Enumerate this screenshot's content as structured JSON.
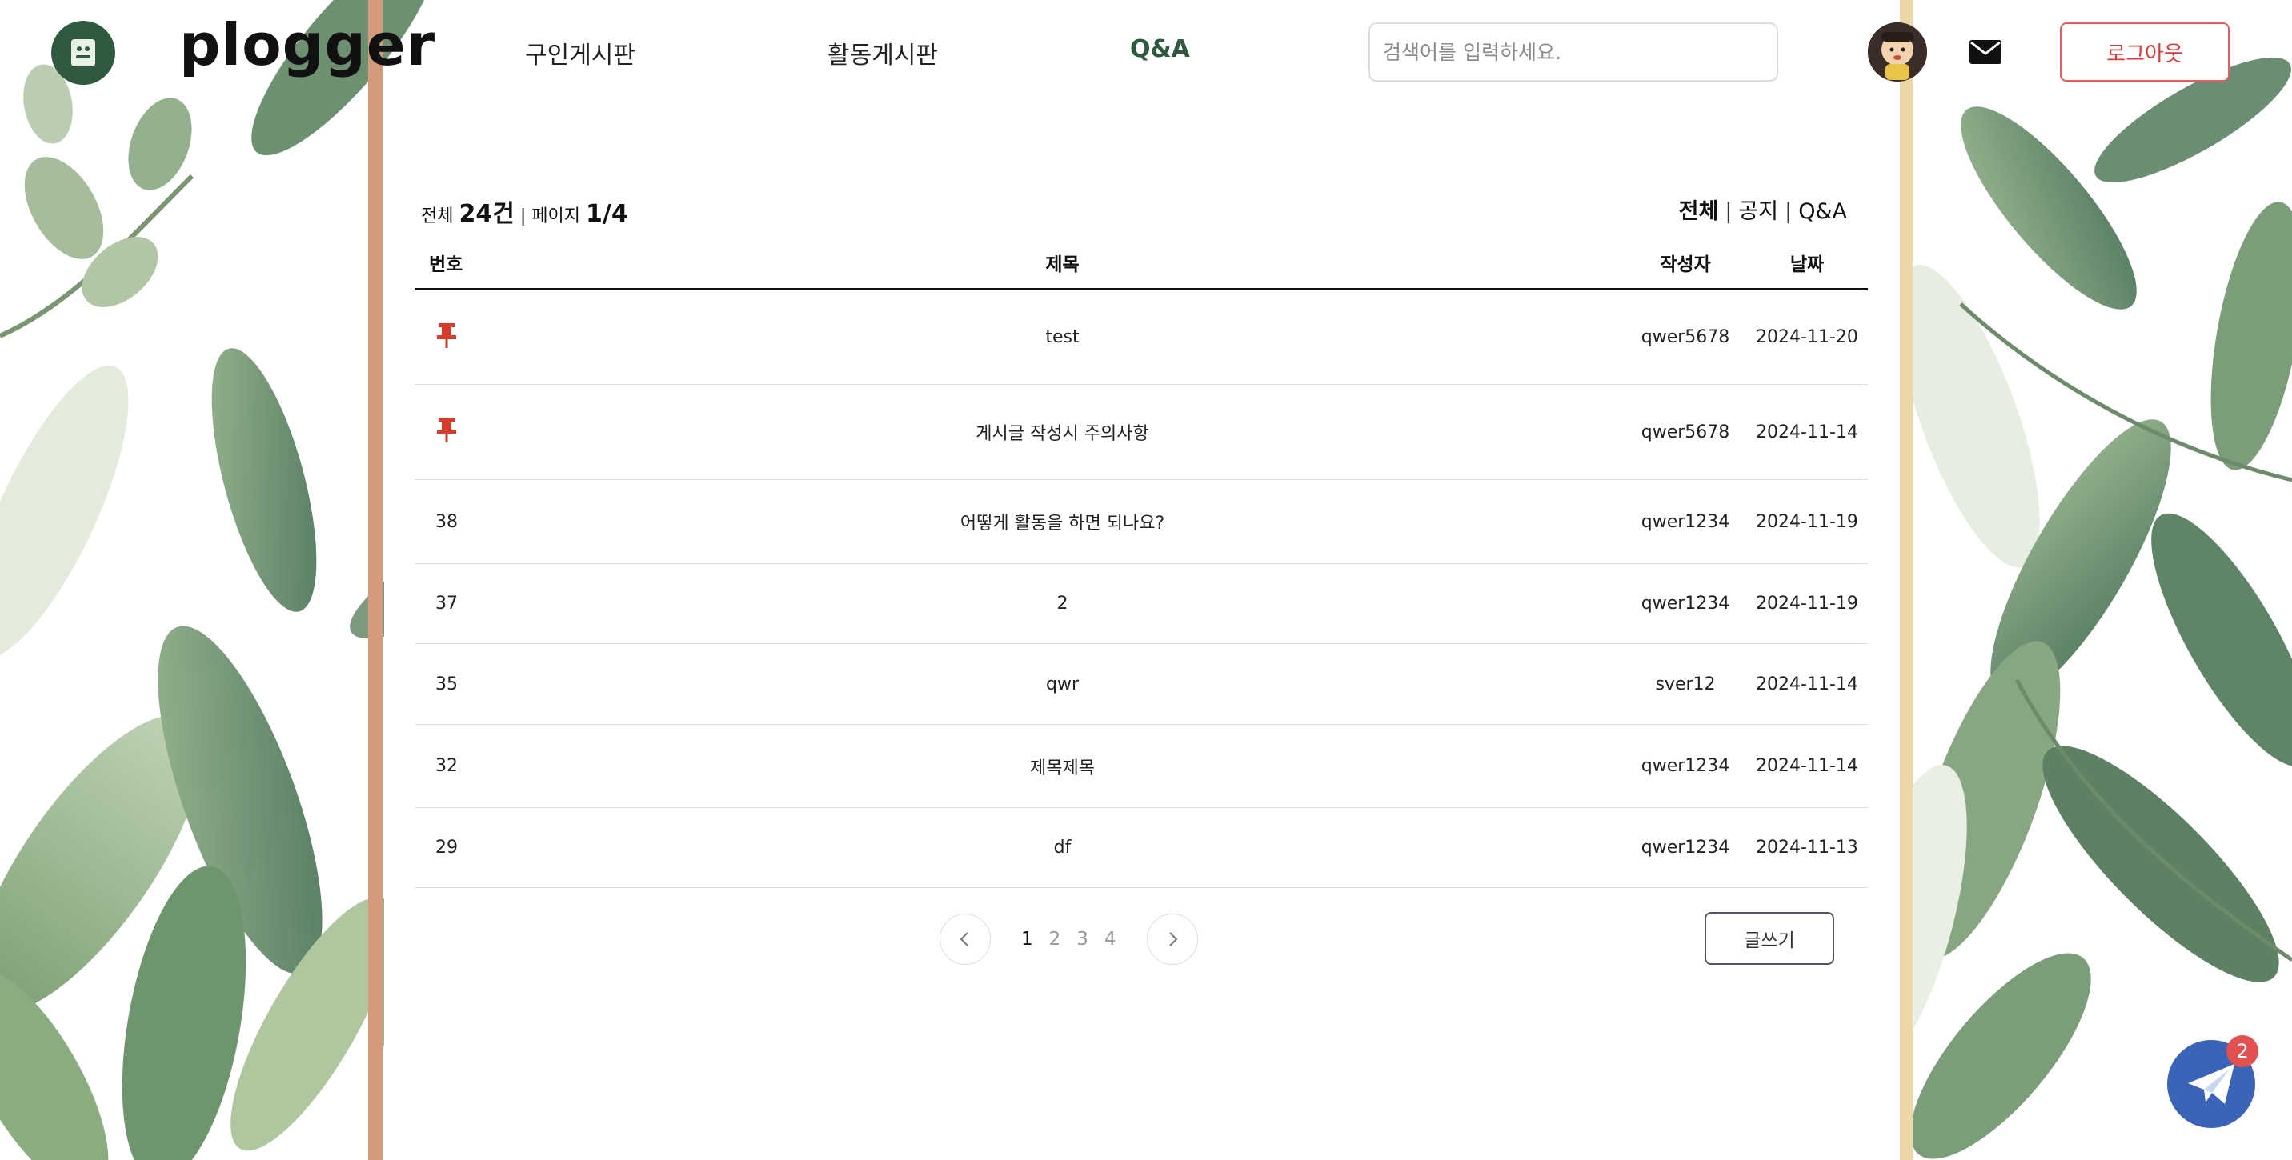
{
  "brand": {
    "name": "plogger"
  },
  "nav": [
    {
      "label": "구인게시판",
      "active": false
    },
    {
      "label": "활동게시판",
      "active": false
    },
    {
      "label": "Q&A",
      "active": true
    }
  ],
  "search": {
    "placeholder": "검색어를 입력하세요."
  },
  "header": {
    "logout_label": "로그아웃",
    "message_icon": "mail-icon",
    "accent_color": "#2f5a40",
    "logout_color": "#d63b3b"
  },
  "summary": {
    "total_prefix": "전체",
    "total_count": "24건",
    "separator": "|",
    "page_prefix": "페이지",
    "page_value": "1/4"
  },
  "filters": [
    {
      "label": "전체",
      "selected": true
    },
    {
      "label": "공지",
      "selected": false
    },
    {
      "label": "Q&A",
      "selected": false
    }
  ],
  "table": {
    "headers": {
      "num": "번호",
      "title": "제목",
      "author": "작성자",
      "date": "날짜"
    },
    "rows": [
      {
        "num": "",
        "pinned": true,
        "title": "test",
        "author": "qwer5678",
        "date": "2024-11-20"
      },
      {
        "num": "",
        "pinned": true,
        "title": "게시글 작성시 주의사항",
        "author": "qwer5678",
        "date": "2024-11-14"
      },
      {
        "num": "38",
        "pinned": false,
        "title": "어떻게 활동을 하면 되나요?",
        "author": "qwer1234",
        "date": "2024-11-19"
      },
      {
        "num": "37",
        "pinned": false,
        "title": "2",
        "author": "qwer1234",
        "date": "2024-11-19"
      },
      {
        "num": "35",
        "pinned": false,
        "title": "qwr",
        "author": "sver12",
        "date": "2024-11-14"
      },
      {
        "num": "32",
        "pinned": false,
        "title": "제목제목",
        "author": "qwer1234",
        "date": "2024-11-14"
      },
      {
        "num": "29",
        "pinned": false,
        "title": "df",
        "author": "qwer1234",
        "date": "2024-11-13"
      }
    ]
  },
  "pagination": {
    "pages": [
      "1",
      "2",
      "3",
      "4"
    ],
    "current": "1"
  },
  "write_button": {
    "label": "글쓰기"
  },
  "chat_fab": {
    "badge": "2",
    "icon": "paper-plane-icon",
    "color": "#3b63b8"
  }
}
